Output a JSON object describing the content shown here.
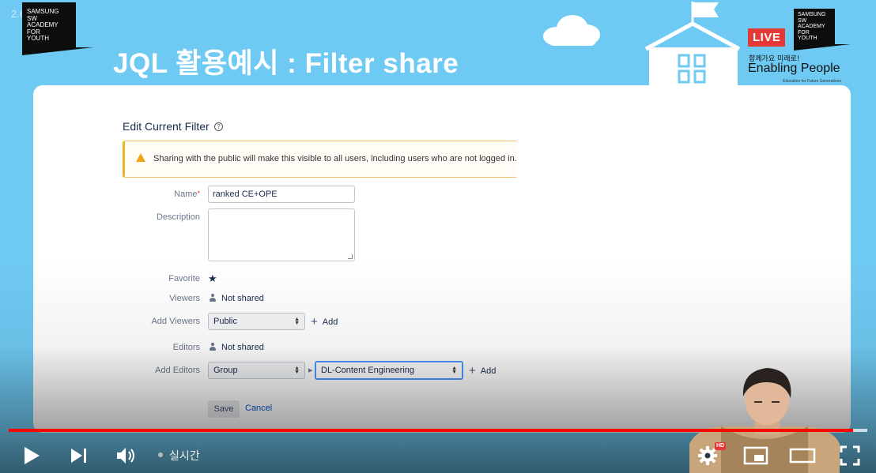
{
  "player": {
    "counter": "2.6W",
    "live_label": "실시간",
    "hd_label": "HD",
    "progress_fraction": 0.983
  },
  "banner": {
    "slide_title": "JQL 활용예시 : Filter share",
    "logo_left_lines": [
      "SAMSUNG",
      "SW",
      "ACADEMY",
      "FOR",
      "YOUTH"
    ],
    "logo_right_lines": [
      "SAMSUNG",
      "SW",
      "ACADEMY",
      "FOR",
      "YOUTH"
    ],
    "live_badge": "LIVE",
    "slogan_small": "함께가요 미래로!",
    "slogan": "Enabling People",
    "slogan_sub": "Education for Future Generations"
  },
  "form": {
    "title": "Edit Current Filter",
    "help_icon": "?",
    "warning_icon": "warning-triangle-icon",
    "warning_text": "Sharing with the public will make this visible to all users, including users who are not logged in.",
    "name_label": "Name",
    "required_mark": "*",
    "name_value": "ranked CE+OPE",
    "description_label": "Description",
    "description_value": "",
    "favorite_label": "Favorite",
    "favorite_icon": "★",
    "viewers_label": "Viewers",
    "viewers_value": "Not shared",
    "add_viewers_label": "Add Viewers",
    "add_viewers_select": "Public",
    "add_label": "Add",
    "editors_label": "Editors",
    "editors_value": "Not shared",
    "add_editors_label": "Add Editors",
    "add_editors_type": "Group",
    "add_editors_group": "DL-Content Engineering",
    "save_label": "Save",
    "cancel_label": "Cancel"
  },
  "colors": {
    "banner_bg": "#6fcaf3",
    "warning_border": "#f0b429",
    "link_blue": "#0052cc",
    "progress_red": "#ff0000"
  }
}
